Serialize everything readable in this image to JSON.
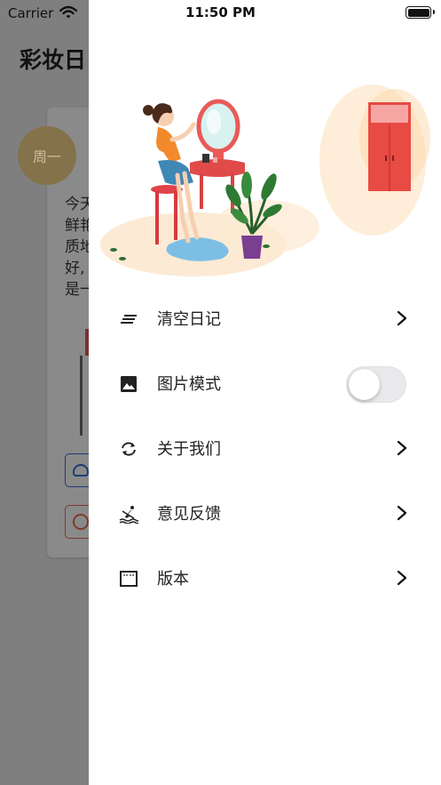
{
  "status_bar": {
    "carrier": "Carrier",
    "time": "11:50 PM",
    "battery_level": 1.0
  },
  "background": {
    "title": "彩妆日",
    "day_badge": "周一",
    "text_lines": [
      "今天",
      "鲜艳",
      "质地",
      "好,",
      "是一"
    ]
  },
  "menu": {
    "items": [
      {
        "label": "清空日记",
        "icon": "list-lines-icon",
        "control": "chevron"
      },
      {
        "label": "图片模式",
        "icon": "image-icon",
        "control": "toggle",
        "toggle_on": false
      },
      {
        "label": "关于我们",
        "icon": "sync-arrows-icon",
        "control": "chevron"
      },
      {
        "label": "意见反馈",
        "icon": "rowing-icon",
        "control": "chevron"
      },
      {
        "label": "版本",
        "icon": "dotted-frame-icon",
        "control": "chevron"
      }
    ]
  },
  "colors": {
    "overlay_dim": "#7f7f7f",
    "drawer_bg": "#ffffff",
    "toggle_off": "#e9e9eb",
    "icon": "#222222"
  }
}
